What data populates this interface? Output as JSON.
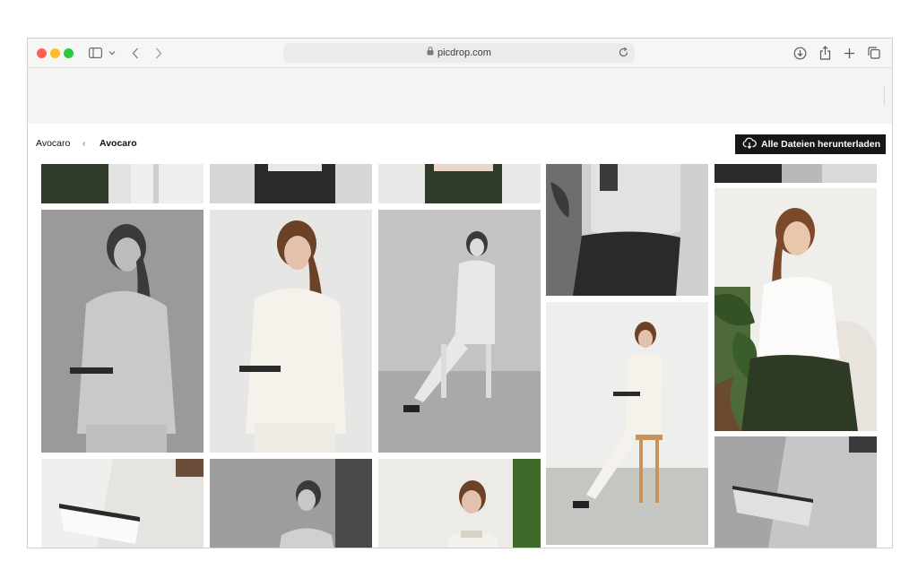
{
  "browser": {
    "url": "picdrop.com",
    "icons": [
      "sidebar-icon",
      "chevron-down-icon",
      "back-icon",
      "forward-icon",
      "lock-icon",
      "reload-icon",
      "download-icon",
      "share-icon",
      "new-tab-icon",
      "tabs-overview-icon"
    ]
  },
  "breadcrumb": {
    "root": "Avocaro",
    "separator": "‹",
    "current": "Avocaro"
  },
  "actions": {
    "download_all": "Alle Dateien herunterladen"
  },
  "colors": {
    "button_bg": "#161616",
    "page_bg": "#ffffff",
    "chrome_bg": "#f4f4f2"
  },
  "gallery": {
    "photos": [
      {
        "alt": "photo-1"
      },
      {
        "alt": "photo-2"
      },
      {
        "alt": "photo-3"
      },
      {
        "alt": "photo-4"
      },
      {
        "alt": "photo-5"
      },
      {
        "alt": "photo-6"
      },
      {
        "alt": "photo-7"
      },
      {
        "alt": "photo-8"
      },
      {
        "alt": "photo-9"
      },
      {
        "alt": "photo-10"
      },
      {
        "alt": "photo-11"
      },
      {
        "alt": "photo-12"
      },
      {
        "alt": "photo-13"
      },
      {
        "alt": "photo-14"
      },
      {
        "alt": "photo-15"
      }
    ]
  }
}
